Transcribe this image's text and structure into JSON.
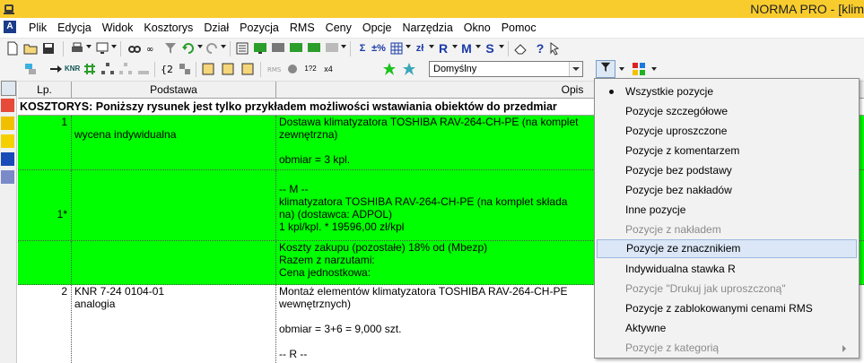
{
  "window": {
    "title": "NORMA PRO - [klim"
  },
  "menubar": {
    "items": [
      "Plik",
      "Edycja",
      "Widok",
      "Kosztorys",
      "Dział",
      "Pozycja",
      "RMS",
      "Ceny",
      "Opcje",
      "Narzędzia",
      "Okno",
      "Pomoc"
    ]
  },
  "toolbar1": {
    "icons": [
      "new-icon",
      "open-icon",
      "save-icon",
      "print-icon",
      "preview-icon",
      "find-icon",
      "link-icon",
      "filter-icon",
      "undo-icon",
      "redo-icon",
      "rms-icon",
      "monitor-icon",
      "sum-icon",
      "percent-icon",
      "table-icon",
      "zl-icon",
      "r-icon",
      "m-icon",
      "s-icon",
      "eraser-icon",
      "help-icon",
      "context-help-icon"
    ],
    "labels": {
      "sum": "Σ",
      "percent": "±%",
      "zl": "zł",
      "r": "R",
      "m": "M",
      "s": "S",
      "help": "?"
    }
  },
  "toolbar2": {
    "labels": {
      "knr": "KNR",
      "num": "1?2",
      "x4": "x4"
    },
    "preset": {
      "value": "Domyślny"
    }
  },
  "grid": {
    "headers": {
      "lp": "Lp.",
      "podstawa": "Podstawa",
      "opis": "Opis"
    },
    "section_title": "KOSZTORYS: Poniższy rysunek jest tylko przykładem możliwości wstawiania obiektów do przedmiar",
    "rows": [
      {
        "lp": "1",
        "podstawa": [
          "",
          "wycena indywidualna"
        ],
        "opis": [
          "Dostawa klimatyzatora TOSHIBA RAV-264-CH-PE (na komplet",
          "zewnętrzna)",
          "",
          "obmiar  = 3 kpl."
        ]
      },
      {
        "lp": "1*",
        "podstawa": [],
        "opis": [
          "",
          "-- M --",
          "klimatyzatora TOSHIBA RAV-264-CH-PE (na komplet składa",
          "na) (dostawca: ADPOL)",
          "1 kpl/kpl. * 19596,00 zł/kpl"
        ]
      },
      {
        "lp": "",
        "podstawa": [],
        "opis": [
          "Koszty zakupu (pozostałe)  18% od (Mbezp)",
          "Razem z narzutami:",
          "Cena jednostkowa:"
        ]
      },
      {
        "lp": "2",
        "podstawa": [
          "KNR 7-24 0104-01",
          "analogia"
        ],
        "opis": [
          "Montaż elementów klimatyzatora TOSHIBA RAV-264-CH-PE",
          "wewnętrznych)",
          "",
          "obmiar  = 3+6 = 9,000 szt.",
          "",
          "-- R --"
        ]
      }
    ]
  },
  "filter_menu": {
    "items": [
      {
        "label": "Wszystkie pozycje",
        "checked": true,
        "disabled": false
      },
      {
        "label": "Pozycje szczegółowe",
        "checked": false,
        "disabled": false
      },
      {
        "label": "Pozycje uproszczone",
        "checked": false,
        "disabled": false
      },
      {
        "label": "Pozycje z komentarzem",
        "checked": false,
        "disabled": false
      },
      {
        "label": "Pozycje bez podstawy",
        "checked": false,
        "disabled": false
      },
      {
        "label": "Pozycje bez nakładów",
        "checked": false,
        "disabled": false
      },
      {
        "label": "Inne pozycje",
        "checked": false,
        "disabled": false
      },
      {
        "label": "Pozycje z nakładem",
        "checked": false,
        "disabled": true
      },
      {
        "label": "Pozycje ze znacznikiem",
        "checked": false,
        "disabled": false,
        "highlighted": true
      },
      {
        "label": "Indywidualna stawka R",
        "checked": false,
        "disabled": false
      },
      {
        "label": "Pozycje \"Drukuj jak uproszczoną\"",
        "checked": false,
        "disabled": true
      },
      {
        "label": "Pozycje z zablokowanymi cenami RMS",
        "checked": false,
        "disabled": false
      },
      {
        "label": "Aktywne",
        "checked": false,
        "disabled": false
      },
      {
        "label": "Pozycje z kategorią",
        "checked": false,
        "disabled": true,
        "submenu": true
      }
    ]
  },
  "colors": {
    "titlebar": "#f9cc2e",
    "row_highlight": "#00ff00",
    "menu_hover": "#dbe7f6"
  }
}
